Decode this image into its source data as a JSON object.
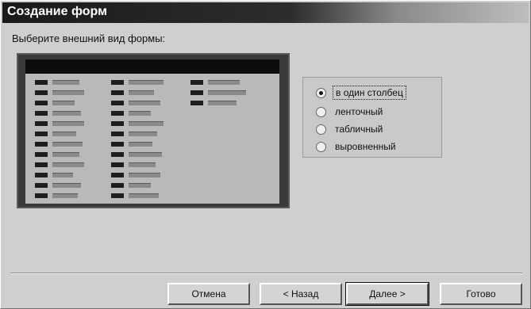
{
  "window": {
    "title": "Создание форм"
  },
  "wizard": {
    "prompt": "Выберите внешний вид формы:",
    "options": [
      {
        "label": "в один столбец",
        "checked": true
      },
      {
        "label": "ленточный",
        "checked": false
      },
      {
        "label": "табличный",
        "checked": false
      },
      {
        "label": "выровненный",
        "checked": false
      }
    ]
  },
  "buttons": {
    "cancel": "Отмена",
    "back": "< Назад",
    "next": "Далее >",
    "finish": "Готово"
  }
}
